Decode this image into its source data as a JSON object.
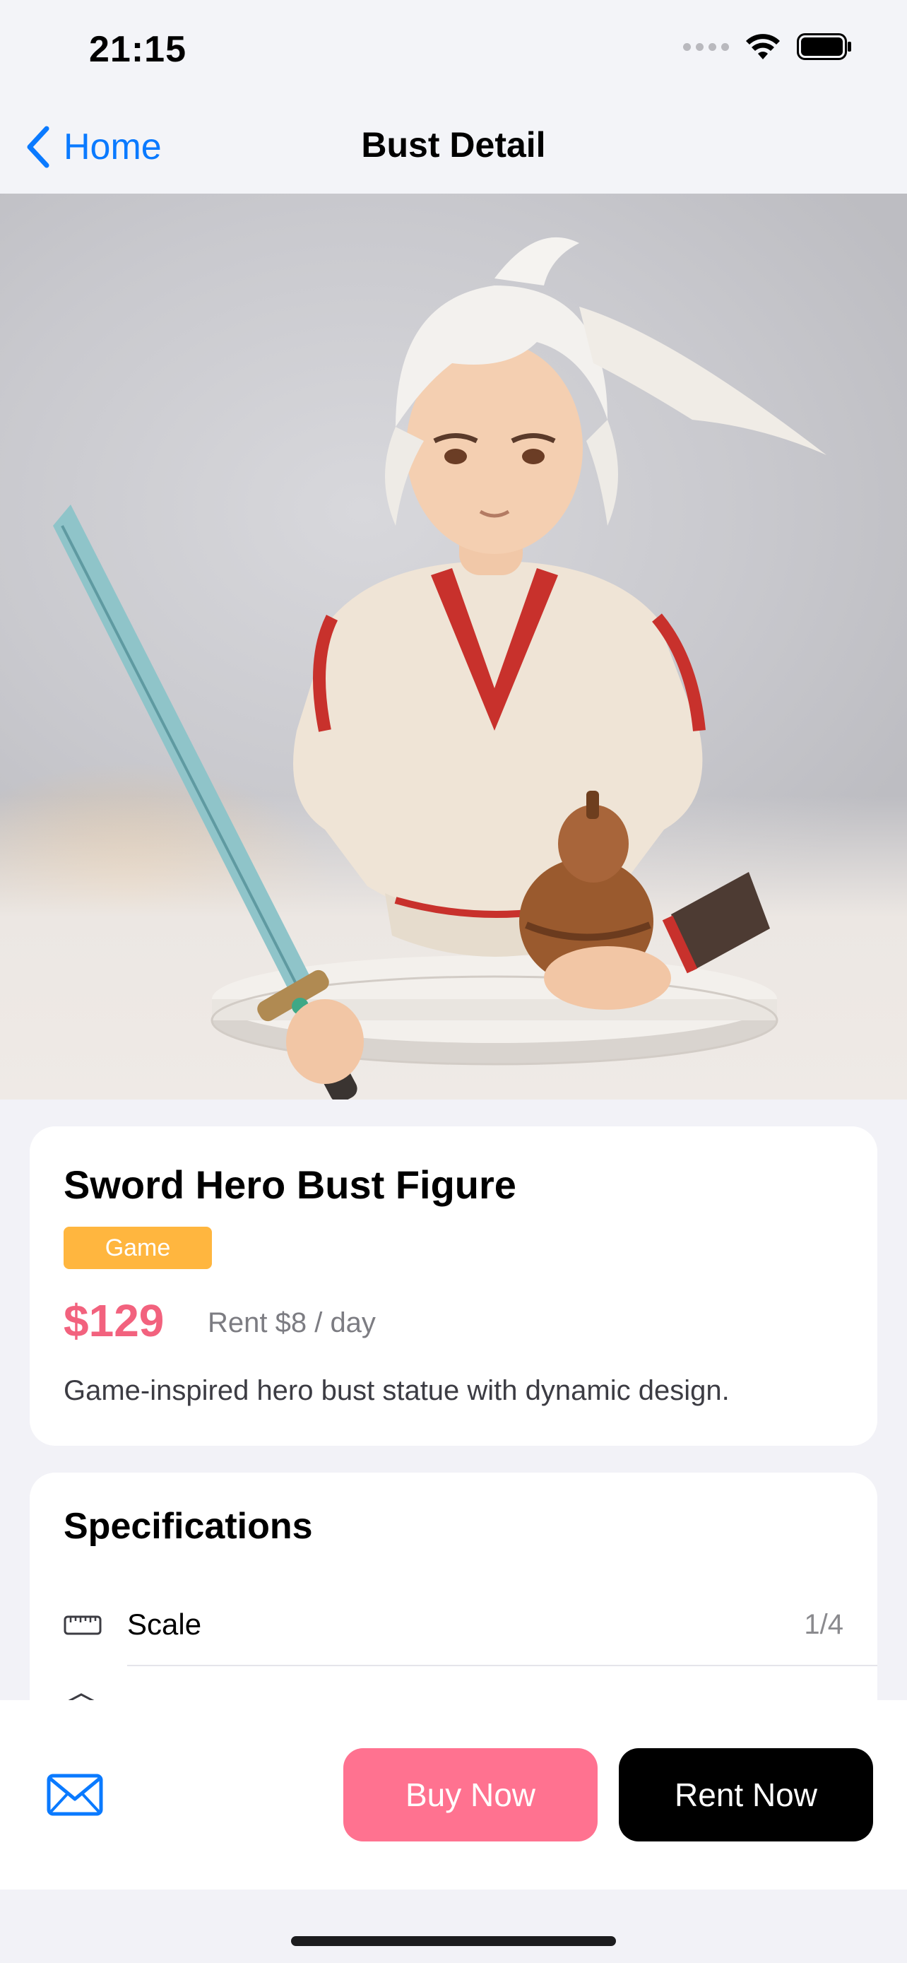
{
  "status_bar": {
    "time": "21:15"
  },
  "nav": {
    "back_label": "Home",
    "title": "Bust Detail"
  },
  "product": {
    "name": "Sword Hero Bust Figure",
    "category": "Game",
    "price": "$129",
    "rent_price": "Rent $8 / day",
    "description": "Game-inspired hero bust statue with dynamic design.",
    "image_icon": "product-photo"
  },
  "specs": {
    "title": "Specifications",
    "items": [
      {
        "icon": "ruler-icon",
        "label": "Scale",
        "value": "1/4"
      }
    ]
  },
  "actions": {
    "buy_label": "Buy Now",
    "rent_label": "Rent Now",
    "contact_icon": "mail-icon"
  },
  "colors": {
    "accent": "#0a7aff",
    "price": "#f2627e",
    "badge": "#ffb63f",
    "buy_button": "#ff7290",
    "rent_button": "#000000"
  }
}
